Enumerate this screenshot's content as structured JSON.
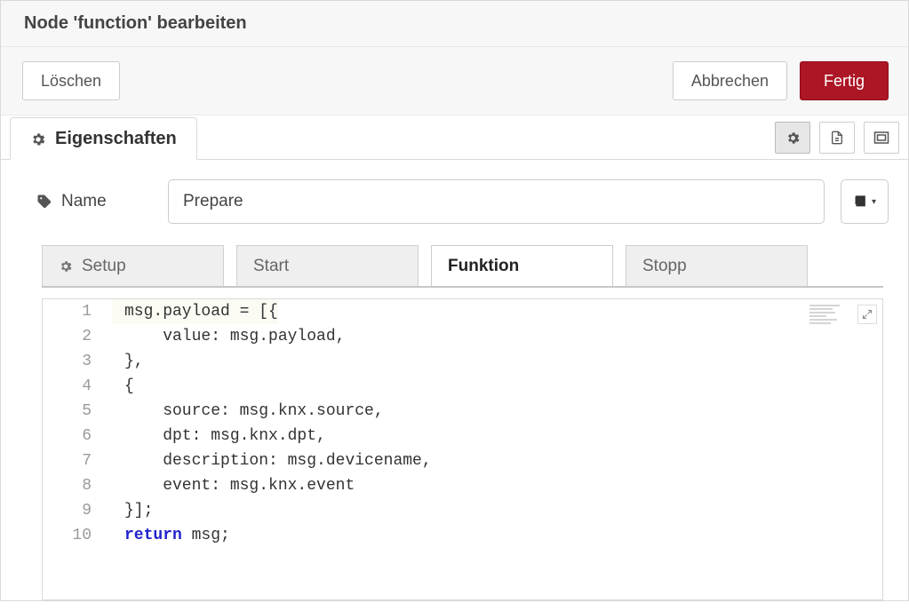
{
  "dialog": {
    "title": "Node 'function' bearbeiten",
    "delete_label": "Löschen",
    "cancel_label": "Abbrechen",
    "done_label": "Fertig"
  },
  "properties_tab_label": "Eigenschaften",
  "name_field": {
    "label": "Name",
    "value": "Prepare"
  },
  "editor_tabs": {
    "setup": "Setup",
    "start": "Start",
    "function": "Funktion",
    "stop": "Stopp"
  },
  "code_lines": [
    {
      "n": "1",
      "text": "msg.payload = [{"
    },
    {
      "n": "2",
      "text": "    value: msg.payload,"
    },
    {
      "n": "3",
      "text": "},"
    },
    {
      "n": "4",
      "text": "{"
    },
    {
      "n": "5",
      "text": "    source: msg.knx.source,"
    },
    {
      "n": "6",
      "text": "    dpt: msg.knx.dpt,"
    },
    {
      "n": "7",
      "text": "    description: msg.devicename,"
    },
    {
      "n": "8",
      "text": "    event: msg.knx.event"
    },
    {
      "n": "9",
      "text": "}];"
    },
    {
      "n": "10",
      "kw": "return",
      "text": " msg;"
    }
  ],
  "icons": {
    "gear": "gear-icon",
    "doc": "document-icon",
    "layout": "layout-icon",
    "tag": "tag-icon",
    "book": "book-icon",
    "caret": "caret-down-icon",
    "expand": "expand-icon"
  }
}
